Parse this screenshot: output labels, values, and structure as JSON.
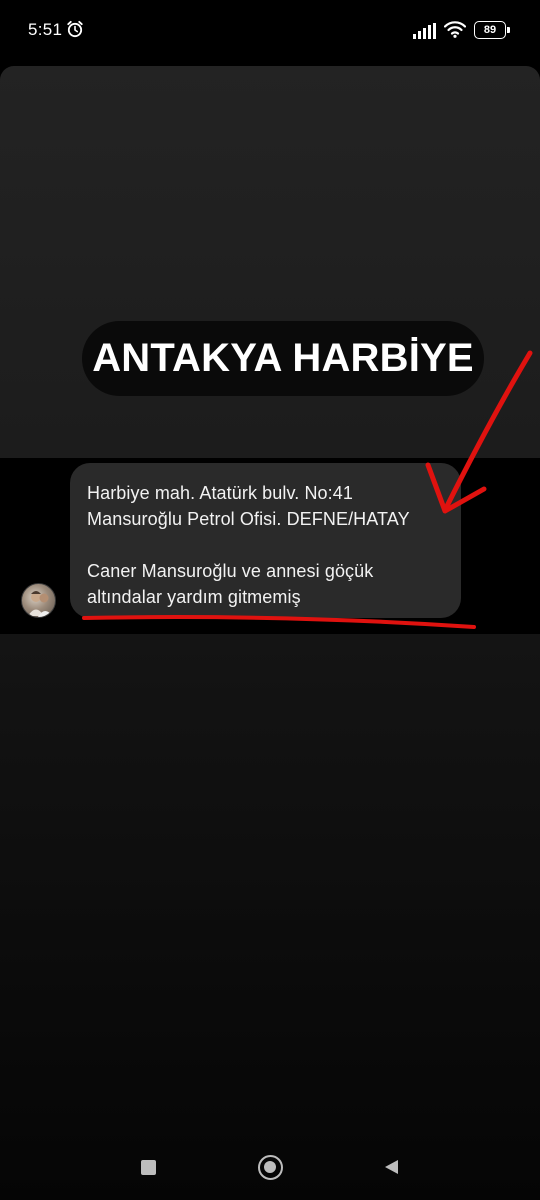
{
  "status_bar": {
    "time": "5:51",
    "battery_level": "89",
    "icons": [
      "alarm-icon",
      "signal-icon",
      "wifi-icon",
      "battery-icon"
    ]
  },
  "story": {
    "title": "ANTAKYA HARBİYE"
  },
  "message": {
    "lines": [
      "Harbiye mah. Atatürk bulv. No:41",
      "Mansuroğlu Petrol Ofisi. DEFNE/HATAY",
      "Caner Mansuroğlu ve annesi göçük",
      "altındalar yardım gitmemiş"
    ]
  },
  "annotations": {
    "color": "#e0120f",
    "marks": [
      "red-arrow",
      "red-underline"
    ]
  },
  "nav_bar": {
    "buttons": [
      "recent-apps-icon",
      "home-icon",
      "back-icon"
    ]
  }
}
